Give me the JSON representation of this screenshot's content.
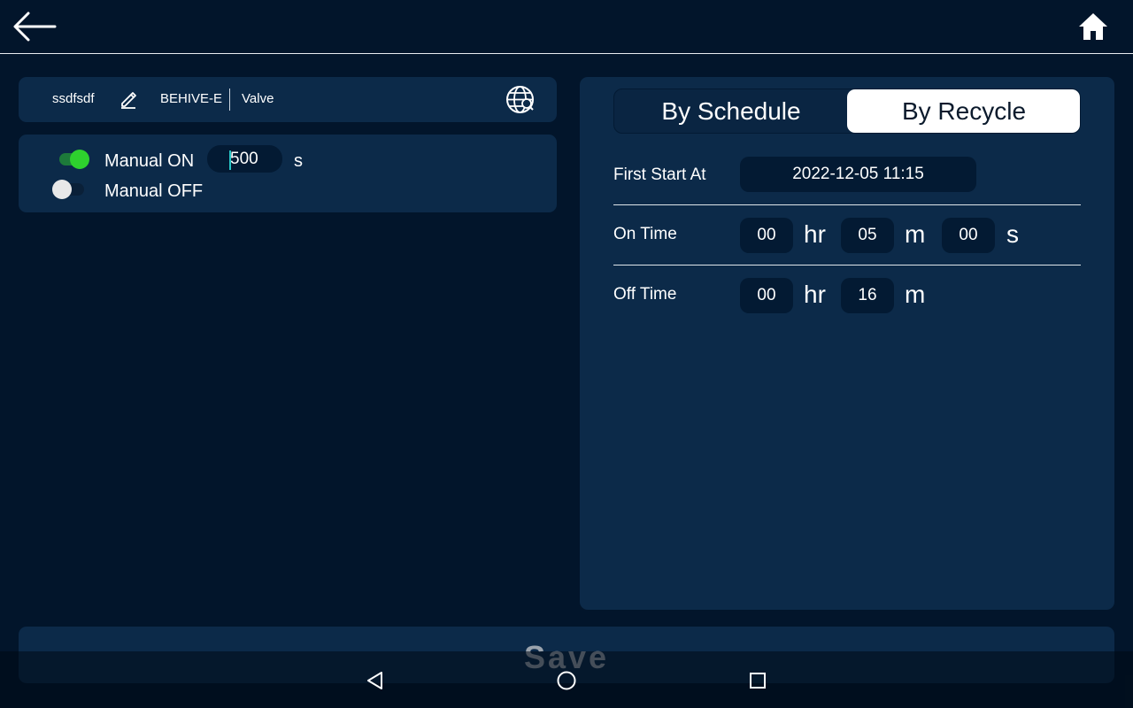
{
  "header": {
    "back_icon": "arrow-left-icon",
    "home_icon": "home-icon"
  },
  "device": {
    "name": "ssdfsdf",
    "model": "BEHIVE-E",
    "type": "Valve",
    "edit_icon": "pencil-icon",
    "globe_icon": "globe-icon"
  },
  "manual": {
    "on_label": "Manual ON",
    "on_enabled": true,
    "on_seconds": "500",
    "unit": "s",
    "off_label": "Manual OFF",
    "off_enabled": false
  },
  "schedule": {
    "tabs": [
      {
        "label": "By Schedule",
        "active": false
      },
      {
        "label": "By Recycle",
        "active": true
      }
    ],
    "first_start": {
      "label": "First Start At",
      "value": "2022-12-05 11:15"
    },
    "on_time": {
      "label": "On Time",
      "hr": "00",
      "m": "05",
      "s": "00"
    },
    "off_time": {
      "label": "Off Time",
      "hr": "00",
      "m": "16"
    },
    "units": {
      "hr": "hr",
      "m": "m",
      "s": "s"
    }
  },
  "footer": {
    "save_label": "Save"
  },
  "system_nav": {
    "back": "triangle-back-icon",
    "home": "circle-home-icon",
    "recents": "square-recents-icon"
  },
  "colors": {
    "background": "#02152b",
    "panel": "#0c2a49",
    "field": "#031a33",
    "toggle_on": "#2ed12e"
  }
}
